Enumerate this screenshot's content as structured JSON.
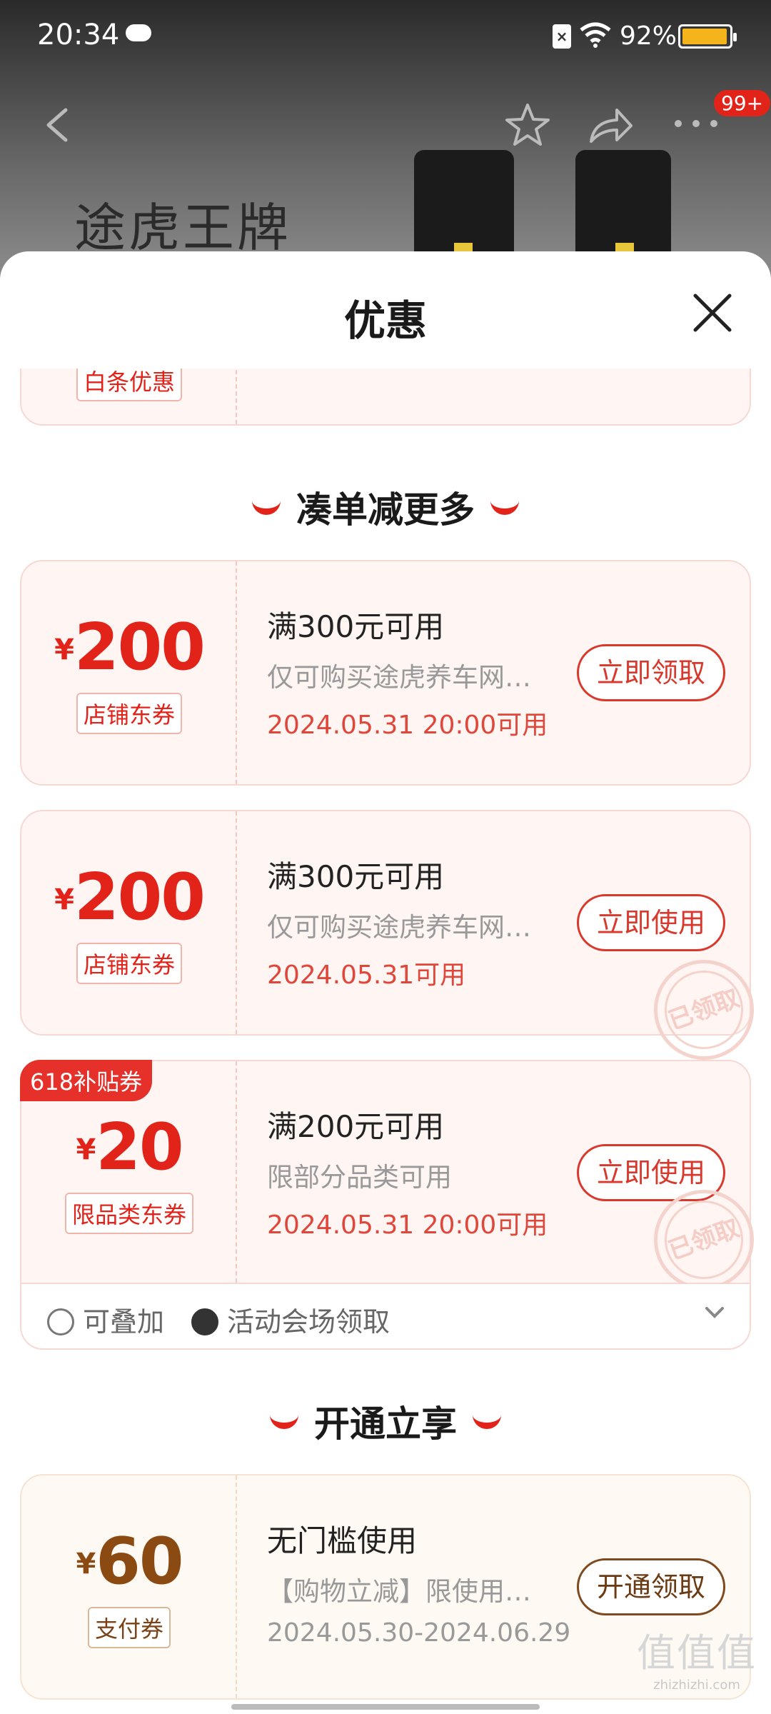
{
  "status_bar": {
    "time": "20:34",
    "battery_pct": "92%",
    "battery_color": "#f5b31c"
  },
  "product_page": {
    "brand_text": "途虎王牌",
    "more_badge": "99+"
  },
  "sheet": {
    "title": "优惠"
  },
  "top_coupon": {
    "tag": "白条优惠"
  },
  "section1": {
    "title": "凑单减更多"
  },
  "coupons": [
    {
      "yen": "¥",
      "amount": "200",
      "tag": "店铺东券",
      "condition": "满300元可用",
      "desc": "仅可购买途虎养车网…",
      "date": "2024.05.31 20:00可用",
      "button": "立即领取"
    },
    {
      "yen": "¥",
      "amount": "200",
      "tag": "店铺东券",
      "condition": "满300元可用",
      "desc": "仅可购买途虎养车网…",
      "date": "2024.05.31可用",
      "button": "立即使用",
      "stamp": "已领取"
    },
    {
      "badge": "618补贴券",
      "yen": "¥",
      "amount": "20",
      "tag": "限品类东券",
      "condition": "满200元可用",
      "desc": "限部分品类可用",
      "date": "2024.05.31 20:00可用",
      "button": "立即使用",
      "stamp": "已领取"
    }
  ],
  "extras": {
    "stackable": "可叠加",
    "venue": "活动会场领取"
  },
  "section2": {
    "title": "开通立享"
  },
  "pay_coupon": {
    "yen": "¥",
    "amount": "60",
    "tag": "支付券",
    "condition": "无门槛使用",
    "desc": "【购物立减】限使用…",
    "date": "2024.05.30-2024.06.29",
    "button": "开通领取"
  },
  "watermark": {
    "main": "值值值",
    "sub": "zhizhizhi.com"
  },
  "colors": {
    "accent": "#e2231a",
    "gold_text": "#8b4a12"
  }
}
